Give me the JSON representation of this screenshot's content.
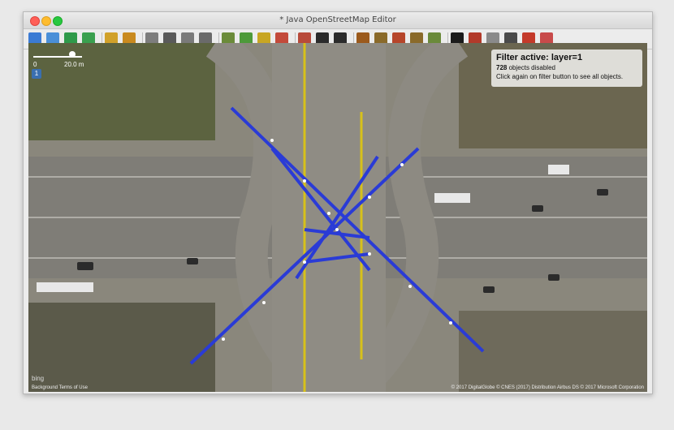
{
  "window": {
    "title": "* Java OpenStreetMap Editor"
  },
  "toolbar": {
    "icons": [
      "open-file-icon",
      "open-location-icon",
      "save-icon",
      "upload-icon",
      "undo-icon",
      "redo-icon",
      "zoom-icon",
      "zoom-layer-icon",
      "download-area-icon",
      "select-icon",
      "refresh-icon",
      "map-tile-icon",
      "traffic-light-icon",
      "traffic-light-2-icon",
      "barrier-icon",
      "car-icon",
      "bus-icon",
      "warning-icon",
      "food-icon",
      "castle-icon",
      "industry-icon",
      "landuse-icon",
      "cursor-icon",
      "split-way-icon",
      "cloud-icon",
      "railway-icon",
      "no-entry-icon",
      "stop-sign-icon"
    ]
  },
  "map": {
    "scale_start": "0",
    "scale_end": "20.0 m",
    "layer_badge": "1",
    "filter_title": "Filter active: layer=1",
    "filter_count": "728",
    "filter_disabled_text": "objects disabled",
    "filter_hint": "Click again on filter button to see all objects.",
    "attribution_left": "Background Terms of Use",
    "attribution_right": "© 2017 DigitalGlobe © CNES (2017) Distribution Airbus DS © 2017 Microsoft Corporation",
    "bing_label": "bing"
  },
  "colors": {
    "way_blue": "#2a3bd6",
    "way_yellow": "#d7c11a",
    "road": "#7b7a74",
    "vegetation": "#4a5a2e"
  }
}
